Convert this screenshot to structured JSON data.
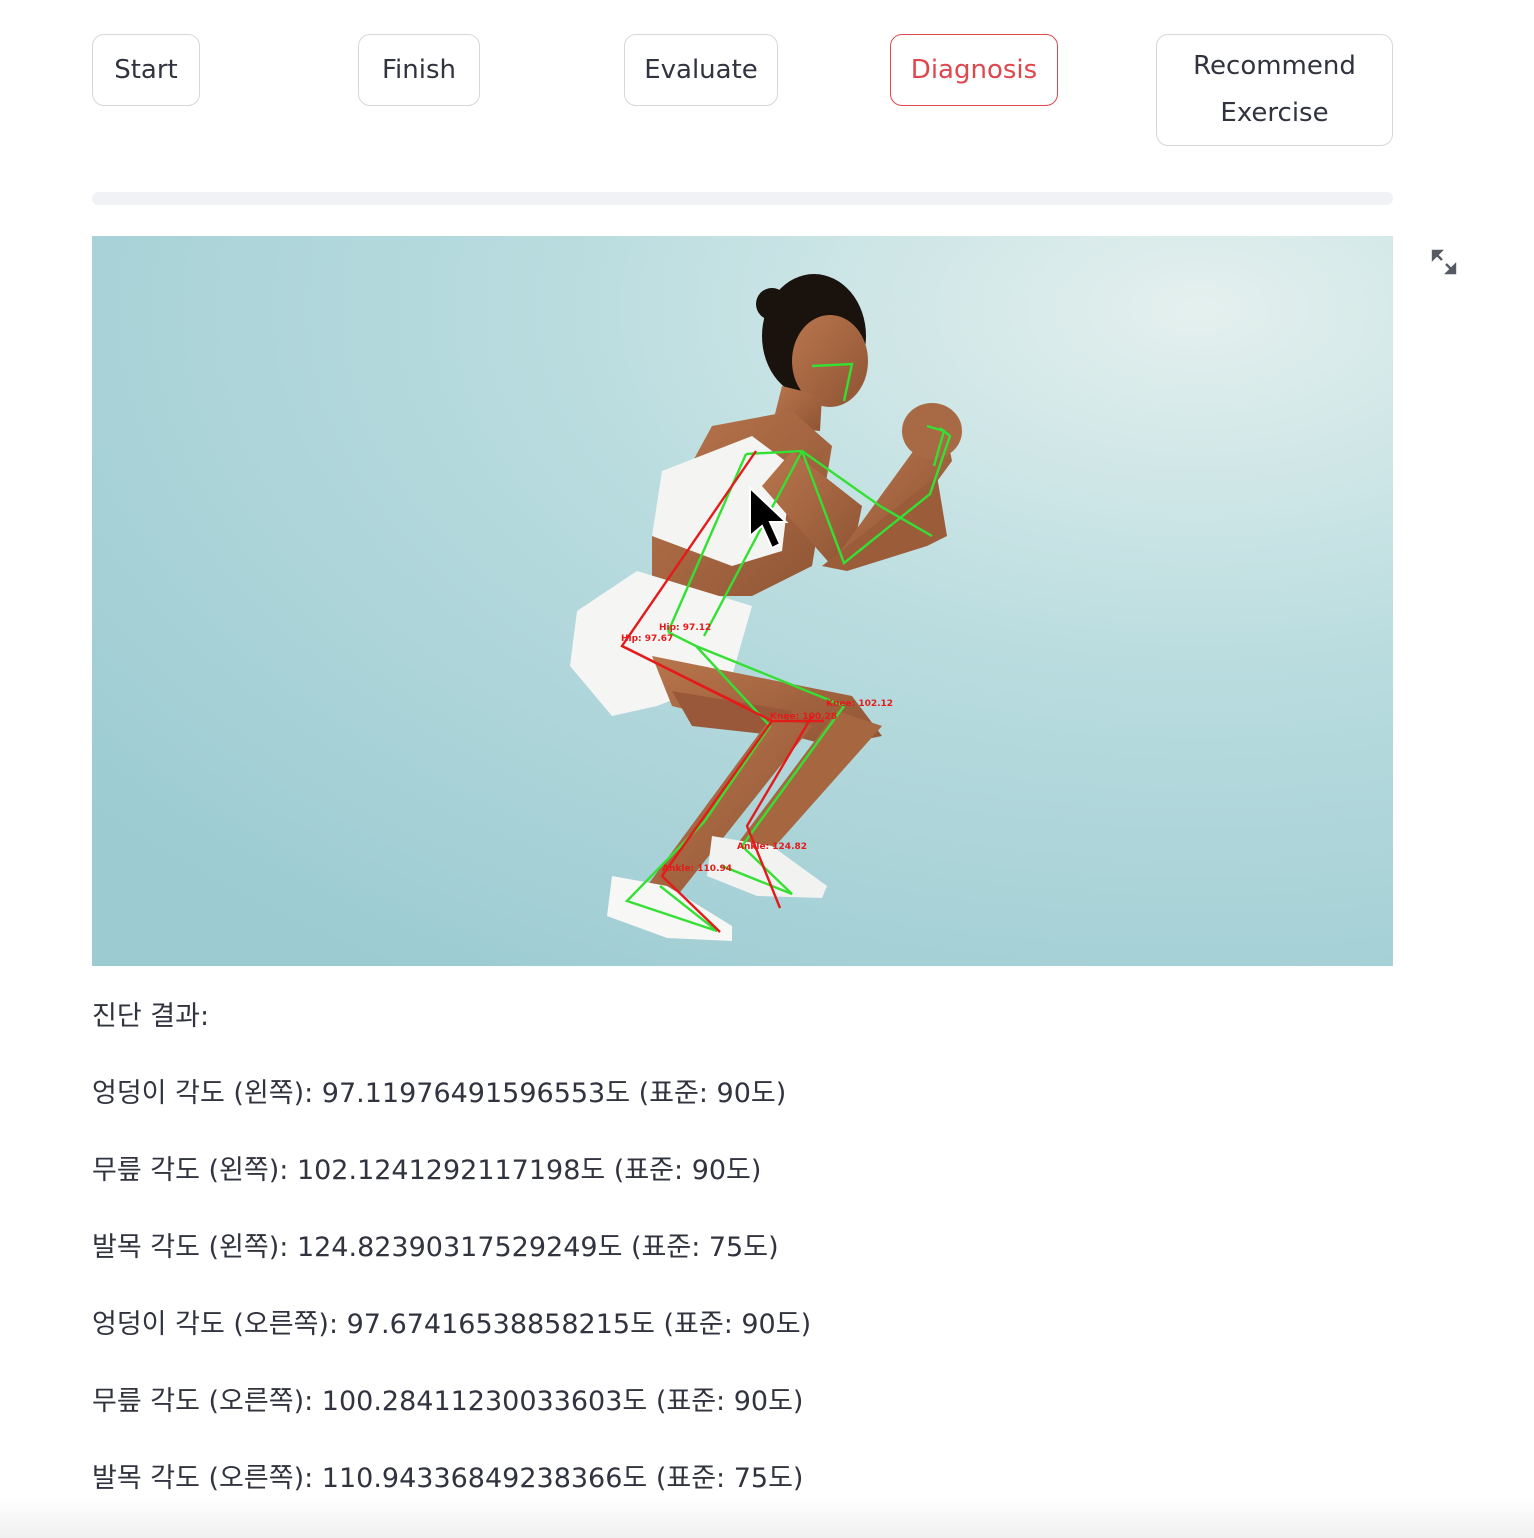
{
  "toolbar": {
    "buttons": [
      {
        "label": "Start",
        "active": false
      },
      {
        "label": "Finish",
        "active": false
      },
      {
        "label": "Evaluate",
        "active": false
      },
      {
        "label": "Diagnosis",
        "active": true
      },
      {
        "label": "Recommend Exercise",
        "active": false
      }
    ]
  },
  "progress": {
    "value": 0
  },
  "image": {
    "description_icon": "pose-estimation-image",
    "overlay_labels": {
      "hip_left": "Hip: 97.12",
      "hip_right": "Hip: 97.67",
      "knee_left": "Knee: 102.12",
      "knee_right": "Knee: 100.28",
      "ankle_left": "Ankle: 124.82",
      "ankle_right": "Ankle: 110.94"
    },
    "colors": {
      "background": "#a9d2d8",
      "left_skeleton": "#34e034",
      "right_skeleton": "#e31b1b"
    }
  },
  "fullscreen": {
    "icon": "expand-icon"
  },
  "diagnosis": {
    "heading": "진단 결과:",
    "lines": [
      "엉덩이 각도 (왼쪽): 97.11976491596553도 (표준: 90도)",
      "무릎 각도 (왼쪽): 102.1241292117198도 (표준: 90도)",
      "발목 각도 (왼쪽): 124.82390317529249도 (표준: 75도)",
      "엉덩이 각도 (오른쪽): 97.67416538858215도 (표준: 90도)",
      "무릎 각도 (오른쪽): 100.28411230033603도 (표준: 90도)",
      "발목 각도 (오른쪽): 110.94336849238366도 (표준: 75도)"
    ]
  },
  "colors": {
    "accent": "#e0474d",
    "text": "#31333f",
    "border": "#d6d7dc"
  }
}
